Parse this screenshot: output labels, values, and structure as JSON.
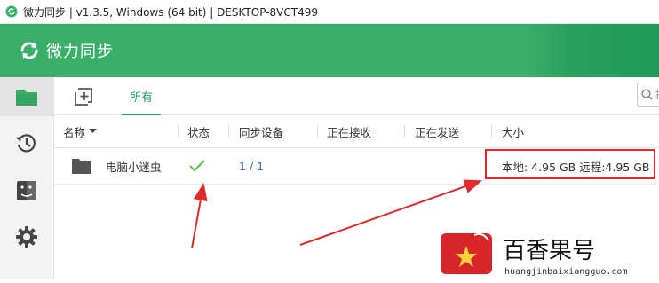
{
  "window": {
    "title": "微力同步 | v1.3.5, Windows (64 bit) | DESKTOP-8VCT499"
  },
  "header": {
    "brand": "微力同步"
  },
  "sidebar": {
    "items": [
      {
        "name": "folders",
        "icon": "folder-icon",
        "active": true
      },
      {
        "name": "history",
        "icon": "history-icon"
      },
      {
        "name": "devices",
        "icon": "finder-icon"
      },
      {
        "name": "settings",
        "icon": "gear-icon"
      }
    ]
  },
  "toolbar": {
    "tab_all": "所有",
    "search_placeholder": "搜"
  },
  "table": {
    "headers": {
      "name": "名称",
      "status": "状态",
      "sync_devices": "同步设备",
      "receiving": "正在接收",
      "sending": "正在发送",
      "size": "大小"
    },
    "rows": [
      {
        "name": "电脑小迷虫",
        "status": "synced",
        "sync_devices": "1 / 1",
        "receiving": "",
        "sending": "",
        "size": "本地: 4.95 GB 远程:4.95 GB"
      }
    ]
  },
  "watermark": {
    "text": "百香果号",
    "sub": "huangjinbaixiangguo.com"
  },
  "colors": {
    "header": "#3aaf6a",
    "accent": "#2d9d5d",
    "annotation": "#e02a2a",
    "check": "#5cbd4b"
  }
}
